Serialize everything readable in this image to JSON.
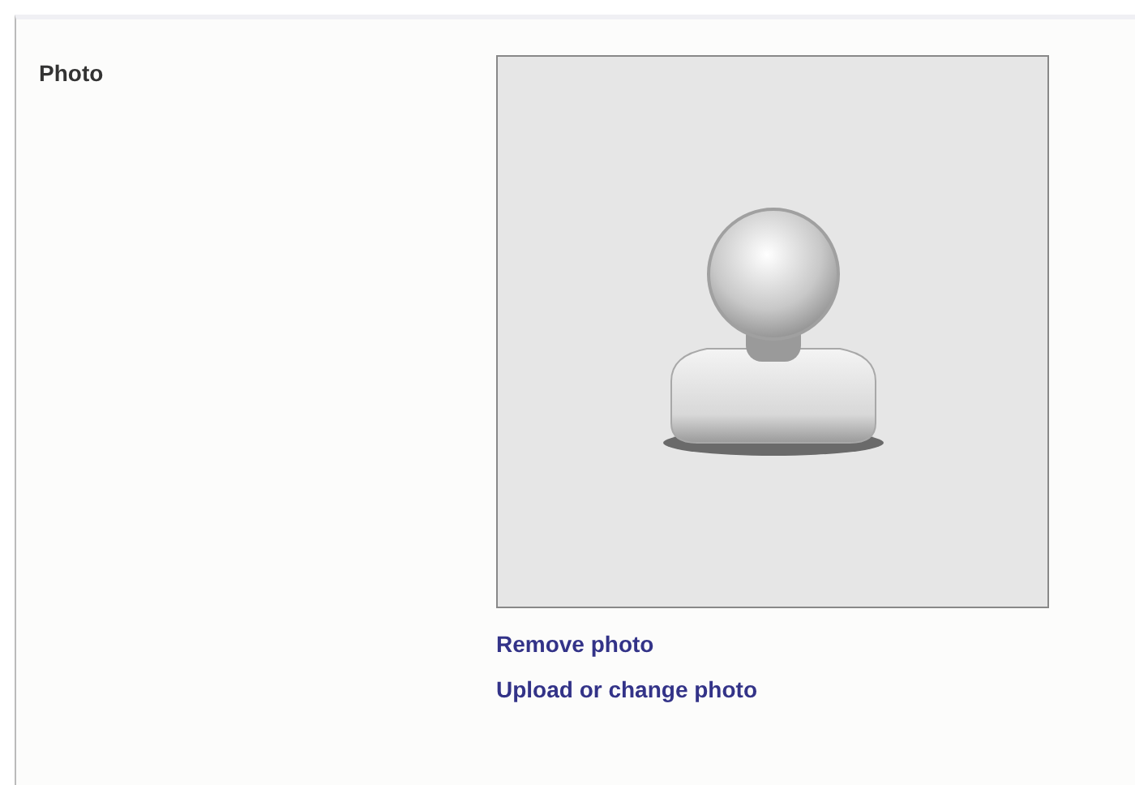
{
  "field": {
    "label": "Photo"
  },
  "photo": {
    "kind": "avatar"
  },
  "links": [
    "Remove photo",
    "Upload or change photo"
  ]
}
